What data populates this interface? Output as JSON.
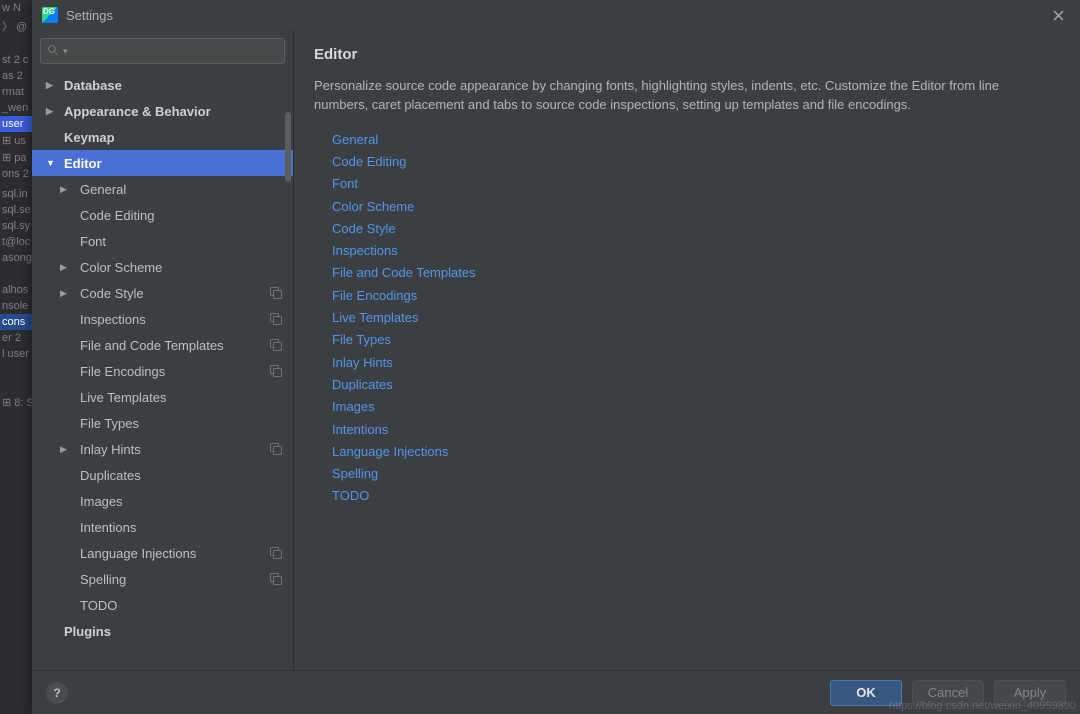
{
  "window": {
    "title": "Settings"
  },
  "search": {
    "placeholder": ""
  },
  "sidebar": {
    "items": [
      {
        "label": "Database",
        "bold": true,
        "arrow": "right",
        "depth": 0
      },
      {
        "label": "Appearance & Behavior",
        "bold": true,
        "arrow": "right",
        "depth": 0
      },
      {
        "label": "Keymap",
        "bold": true,
        "arrow": "",
        "depth": 0
      },
      {
        "label": "Editor",
        "bold": true,
        "arrow": "down",
        "depth": 0,
        "selected": true
      },
      {
        "label": "General",
        "arrow": "right",
        "depth": 1
      },
      {
        "label": "Code Editing",
        "arrow": "",
        "depth": 1
      },
      {
        "label": "Font",
        "arrow": "",
        "depth": 1
      },
      {
        "label": "Color Scheme",
        "arrow": "right",
        "depth": 1
      },
      {
        "label": "Code Style",
        "arrow": "right",
        "depth": 1,
        "badge": true
      },
      {
        "label": "Inspections",
        "arrow": "",
        "depth": 1,
        "badge": true
      },
      {
        "label": "File and Code Templates",
        "arrow": "",
        "depth": 1,
        "badge": true
      },
      {
        "label": "File Encodings",
        "arrow": "",
        "depth": 1,
        "badge": true
      },
      {
        "label": "Live Templates",
        "arrow": "",
        "depth": 1
      },
      {
        "label": "File Types",
        "arrow": "",
        "depth": 1
      },
      {
        "label": "Inlay Hints",
        "arrow": "right",
        "depth": 1,
        "badge": true
      },
      {
        "label": "Duplicates",
        "arrow": "",
        "depth": 1
      },
      {
        "label": "Images",
        "arrow": "",
        "depth": 1
      },
      {
        "label": "Intentions",
        "arrow": "",
        "depth": 1
      },
      {
        "label": "Language Injections",
        "arrow": "",
        "depth": 1,
        "badge": true
      },
      {
        "label": "Spelling",
        "arrow": "",
        "depth": 1,
        "badge": true
      },
      {
        "label": "TODO",
        "arrow": "",
        "depth": 1
      },
      {
        "label": "Plugins",
        "bold": true,
        "arrow": "",
        "depth": 0
      }
    ]
  },
  "page": {
    "title": "Editor",
    "description": "Personalize source code appearance by changing fonts, highlighting styles, indents, etc. Customize the Editor from line numbers, caret placement and tabs to source code inspections, setting up templates and file encodings.",
    "links": [
      "General",
      "Code Editing",
      "Font",
      "Color Scheme",
      "Code Style",
      "Inspections",
      "File and Code Templates",
      "File Encodings",
      "Live Templates",
      "File Types",
      "Inlay Hints",
      "Duplicates",
      "Images",
      "Intentions",
      "Language Injections",
      "Spelling",
      "TODO"
    ]
  },
  "footer": {
    "help": "?",
    "ok": "OK",
    "cancel": "Cancel",
    "apply": "Apply"
  },
  "bg": {
    "lines": [
      "w   N",
      "〉 @",
      "",
      "",
      "",
      "",
      "st  2 c",
      "as  2",
      "rmat",
      "_wen",
      "user",
      "⊞ us",
      "⊞ pa",
      "ons  2",
      "",
      "sql.in",
      "sql.se",
      "sql.sy",
      "t@loc",
      "asong",
      "",
      "",
      " ",
      "",
      "alhos",
      "nsole",
      "cons",
      "er  2",
      "l user",
      "",
      "",
      "",
      "",
      "",
      "",
      "",
      "",
      "⊞ 8: S"
    ],
    "hl_index": 10,
    "hl2_index": 26
  },
  "watermark": "https://blog.csdn.net/weixin_40959890"
}
